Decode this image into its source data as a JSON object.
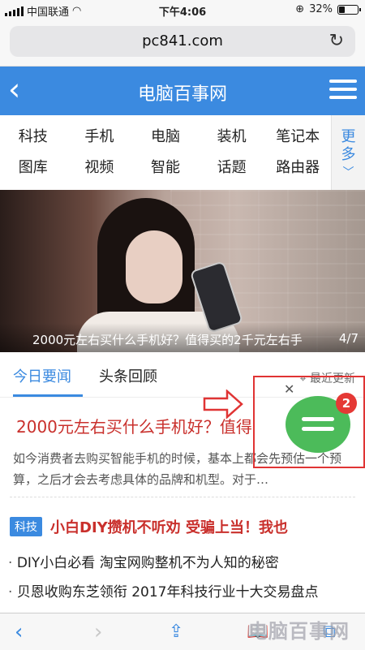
{
  "status_bar": {
    "carrier": "中国联通",
    "time": "下午4:06",
    "battery_text": "32%",
    "battery_level": 0.32
  },
  "browser": {
    "url": "pc841.com"
  },
  "site": {
    "title": "电脑百事网"
  },
  "nav": {
    "items": [
      "科技",
      "手机",
      "电脑",
      "装机",
      "笔记本",
      "图库",
      "视频",
      "智能",
      "话题",
      "路由器"
    ],
    "more_label": "更多"
  },
  "banner": {
    "caption": "2000元左右买什么手机好？值得买的2千元左右手",
    "counter": "4/7"
  },
  "tabs": {
    "active": "今日要闻",
    "inactive": "头条回顾",
    "latest_update": "最近更新"
  },
  "article": {
    "headline": "2000元左右买什么手机好？值得",
    "summary": "如今消费者去购买智能手机的时候，基本上都会先预估一个预算，之后才会去考虑具体的品牌和机型。对于…"
  },
  "tech_section": {
    "tag": "科技",
    "title": "小白DIY攒机不听劝 受骗上当！我也"
  },
  "news_list": [
    "DIY小白必看 淘宝网购整机不为人知的秘密",
    "贝恩收购东芝领衔 2017年科技行业十大交易盘点"
  ],
  "widget": {
    "badge_count": "2",
    "bubble_color": "#4cbb5a",
    "annotation_color": "#e03434"
  },
  "watermark": "电脑百事网",
  "colors": {
    "accent": "#3b8ae0",
    "headline_red": "#c9302c"
  }
}
